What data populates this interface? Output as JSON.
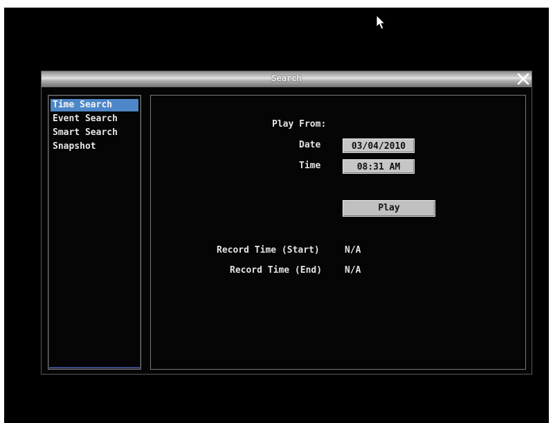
{
  "dialog": {
    "title": "Search",
    "close_icon": "close-icon"
  },
  "sidebar": {
    "items": [
      {
        "label": "Time Search",
        "selected": true
      },
      {
        "label": "Event Search",
        "selected": false
      },
      {
        "label": "Smart Search",
        "selected": false
      },
      {
        "label": "Snapshot",
        "selected": false
      }
    ]
  },
  "main": {
    "play_from_label": "Play From:",
    "date_label": "Date",
    "date_value": "03/04/2010",
    "time_label": "Time",
    "time_value": "08:31 AM",
    "play_button": "Play",
    "record_start_label": "Record Time (Start)",
    "record_start_value": "N/A",
    "record_end_label": "Record Time (End)",
    "record_end_value": "N/A"
  },
  "colors": {
    "selected_item": "#4d87c7",
    "background": "#000000"
  },
  "cursor_icon": "mouse-pointer-icon"
}
